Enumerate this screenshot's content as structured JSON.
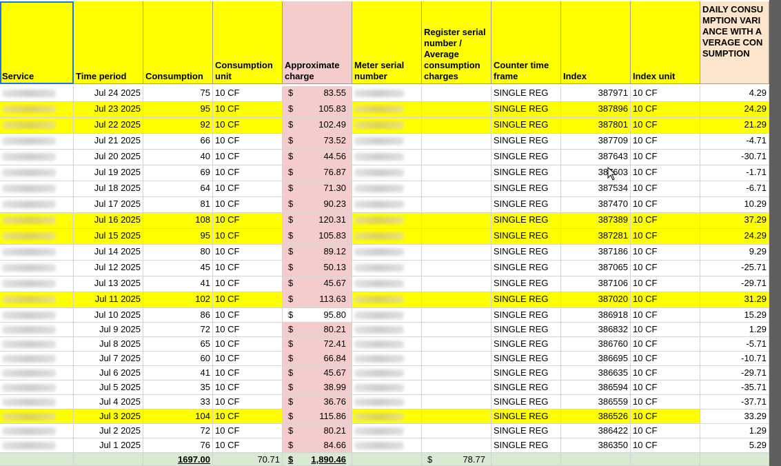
{
  "columns": [
    {
      "key": "service",
      "label": "Service",
      "selected": true
    },
    {
      "key": "time_period",
      "label": "Time period"
    },
    {
      "key": "consumption",
      "label": "Consumption"
    },
    {
      "key": "consumption_unit",
      "label": "Consumption unit"
    },
    {
      "key": "approximate_charge",
      "label": "Approximate charge"
    },
    {
      "key": "meter_serial_number",
      "label": "Meter serial number"
    },
    {
      "key": "register_serial",
      "label": "Register serial number / Average consumption charges"
    },
    {
      "key": "counter_time_frame",
      "label": "Counter time frame"
    },
    {
      "key": "index",
      "label": "Index"
    },
    {
      "key": "index_unit",
      "label": "Index unit"
    },
    {
      "key": "daily_variance",
      "label": "DAILY CONSUMPTION VARIANCE WITH AVERAGE CONSUMPTION"
    }
  ],
  "rows": [
    {
      "date": "Jul 24 2025",
      "consumption": "75",
      "unit": "10 CF",
      "charge": "83.55",
      "counter": "SINGLE REG",
      "index": "387971",
      "index_unit": "10 CF",
      "variance": "4.29",
      "highlight": false
    },
    {
      "date": "Jul 23 2025",
      "consumption": "95",
      "unit": "10 CF",
      "charge": "105.83",
      "counter": "SINGLE REG",
      "index": "387896",
      "index_unit": "10 CF",
      "variance": "24.29",
      "highlight": true
    },
    {
      "date": "Jul 22 2025",
      "consumption": "92",
      "unit": "10 CF",
      "charge": "102.49",
      "counter": "SINGLE REG",
      "index": "387801",
      "index_unit": "10 CF",
      "variance": "21.29",
      "highlight": true
    },
    {
      "date": "Jul 21 2025",
      "consumption": "66",
      "unit": "10 CF",
      "charge": "73.52",
      "counter": "SINGLE REG",
      "index": "387709",
      "index_unit": "10 CF",
      "variance": "-4.71",
      "highlight": false
    },
    {
      "date": "Jul 20 2025",
      "consumption": "40",
      "unit": "10 CF",
      "charge": "44.56",
      "counter": "SINGLE REG",
      "index": "387643",
      "index_unit": "10 CF",
      "variance": "-30.71",
      "highlight": false
    },
    {
      "date": "Jul 19 2025",
      "consumption": "69",
      "unit": "10 CF",
      "charge": "76.87",
      "counter": "SINGLE REG",
      "index": "387603",
      "index_unit": "10 CF",
      "variance": "-1.71",
      "highlight": false
    },
    {
      "date": "Jul 18 2025",
      "consumption": "64",
      "unit": "10 CF",
      "charge": "71.30",
      "counter": "SINGLE REG",
      "index": "387534",
      "index_unit": "10 CF",
      "variance": "-6.71",
      "highlight": false
    },
    {
      "date": "Jul 17 2025",
      "consumption": "81",
      "unit": "10 CF",
      "charge": "90.23",
      "counter": "SINGLE REG",
      "index": "387470",
      "index_unit": "10 CF",
      "variance": "10.29",
      "highlight": false
    },
    {
      "date": "Jul 16 2025",
      "consumption": "108",
      "unit": "10 CF",
      "charge": "120.31",
      "counter": "SINGLE REG",
      "index": "387389",
      "index_unit": "10 CF",
      "variance": "37.29",
      "highlight": true
    },
    {
      "date": "Jul 15 2025",
      "consumption": "95",
      "unit": "10 CF",
      "charge": "105.83",
      "counter": "SINGLE REG",
      "index": "387281",
      "index_unit": "10 CF",
      "variance": "24.29",
      "highlight": true
    },
    {
      "date": "Jul 14 2025",
      "consumption": "80",
      "unit": "10 CF",
      "charge": "89.12",
      "counter": "SINGLE REG",
      "index": "387186",
      "index_unit": "10 CF",
      "variance": "9.29",
      "highlight": false
    },
    {
      "date": "Jul 12 2025",
      "consumption": "45",
      "unit": "10 CF",
      "charge": "50.13",
      "counter": "SINGLE REG",
      "index": "387065",
      "index_unit": "10 CF",
      "variance": "-25.71",
      "highlight": false
    },
    {
      "date": "Jul 13 2025",
      "consumption": "41",
      "unit": "10 CF",
      "charge": "45.67",
      "counter": "SINGLE REG",
      "index": "387106",
      "index_unit": "10 CF",
      "variance": "-29.71",
      "highlight": false
    },
    {
      "date": "Jul 11 2025",
      "consumption": "102",
      "unit": "10 CF",
      "charge": "113.63",
      "counter": "SINGLE REG",
      "index": "387020",
      "index_unit": "10 CF",
      "variance": "31.29",
      "highlight": true
    },
    {
      "date": "Jul 10 2025",
      "consumption": "86",
      "unit": "10 CF",
      "charge": "95.80",
      "counter": "SINGLE REG",
      "index": "386918",
      "index_unit": "10 CF",
      "variance": "15.29",
      "highlight": false,
      "charge_plain": true
    },
    {
      "date": "Jul 9 2025",
      "consumption": "72",
      "unit": "10 CF",
      "charge": "80.21",
      "counter": "SINGLE REG",
      "index": "386832",
      "index_unit": "10 CF",
      "variance": "1.29",
      "highlight": false
    },
    {
      "date": "Jul 8 2025",
      "consumption": "65",
      "unit": "10 CF",
      "charge": "72.41",
      "counter": "SINGLE REG",
      "index": "386760",
      "index_unit": "10 CF",
      "variance": "-5.71",
      "highlight": false
    },
    {
      "date": "Jul 7 2025",
      "consumption": "60",
      "unit": "10 CF",
      "charge": "66.84",
      "counter": "SINGLE REG",
      "index": "386695",
      "index_unit": "10 CF",
      "variance": "-10.71",
      "highlight": false
    },
    {
      "date": "Jul 6 2025",
      "consumption": "41",
      "unit": "10 CF",
      "charge": "45.67",
      "counter": "SINGLE REG",
      "index": "386635",
      "index_unit": "10 CF",
      "variance": "-29.71",
      "highlight": false
    },
    {
      "date": "Jul 5 2025",
      "consumption": "35",
      "unit": "10 CF",
      "charge": "38.99",
      "counter": "SINGLE REG",
      "index": "386594",
      "index_unit": "10 CF",
      "variance": "-35.71",
      "highlight": false
    },
    {
      "date": "Jul 4 2025",
      "consumption": "33",
      "unit": "10 CF",
      "charge": "36.76",
      "counter": "SINGLE REG",
      "index": "386559",
      "index_unit": "10 CF",
      "variance": "-37.71",
      "highlight": false
    },
    {
      "date": "Jul 3 2025",
      "consumption": "104",
      "unit": "10 CF",
      "charge": "115.86",
      "counter": "SINGLE REG",
      "index": "386526",
      "index_unit": "10 CF",
      "variance": "33.29",
      "highlight": true,
      "variance_plain": true
    },
    {
      "date": "Jul 2 2025",
      "consumption": "72",
      "unit": "10 CF",
      "charge": "80.21",
      "counter": "SINGLE REG",
      "index": "386422",
      "index_unit": "10 CF",
      "variance": "1.29",
      "highlight": false
    },
    {
      "date": "Jul 1 2025",
      "consumption": "76",
      "unit": "10 CF",
      "charge": "84.66",
      "counter": "SINGLE REG",
      "index": "386350",
      "index_unit": "10 CF",
      "variance": "5.29",
      "highlight": false
    }
  ],
  "currency_symbol": "$",
  "totals": {
    "consumption": "1697.00",
    "avg_consumption": "70.71",
    "charge": "1,890.46",
    "avg_charge": "78.77"
  },
  "colors": {
    "highlight": "#ffff00",
    "charge_fill": "#f4cccc",
    "variance_header": "#fce5cd",
    "totals_fill": "#d9ead3",
    "selection": "#1a73e8",
    "scrollbar": "#5f5f5f"
  },
  "icons": {
    "cursor": "mouse-pointer-icon"
  }
}
